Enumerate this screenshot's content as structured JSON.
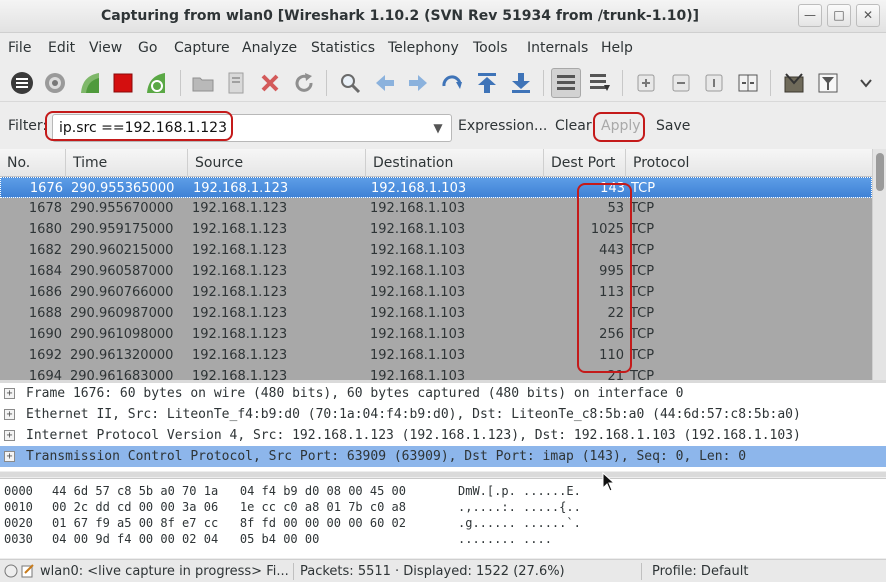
{
  "window": {
    "title": "Capturing from wlan0    [Wireshark 1.10.2  (SVN Rev 51934 from /trunk-1.10)]"
  },
  "menu": [
    "File",
    "Edit",
    "View",
    "Go",
    "Capture",
    "Analyze",
    "Statistics",
    "Telephony",
    "Tools",
    "Internals",
    "Help"
  ],
  "filter": {
    "label": "Filter:",
    "value": "ip.src ==192.168.1.123",
    "expression": "Expression...",
    "clear": "Clear",
    "apply": "Apply",
    "save": "Save"
  },
  "packet_list": {
    "columns": [
      "No.",
      "Time",
      "Source",
      "Destination",
      "Dest Port",
      "Protocol"
    ],
    "rows": [
      {
        "no": "1676",
        "time": "290.955365000",
        "src": "192.168.1.123",
        "dst": "192.168.1.103",
        "port": "143",
        "proto": "TCP"
      },
      {
        "no": "1678",
        "time": "290.955670000",
        "src": "192.168.1.123",
        "dst": "192.168.1.103",
        "port": "53",
        "proto": "TCP"
      },
      {
        "no": "1680",
        "time": "290.959175000",
        "src": "192.168.1.123",
        "dst": "192.168.1.103",
        "port": "1025",
        "proto": "TCP"
      },
      {
        "no": "1682",
        "time": "290.960215000",
        "src": "192.168.1.123",
        "dst": "192.168.1.103",
        "port": "443",
        "proto": "TCP"
      },
      {
        "no": "1684",
        "time": "290.960587000",
        "src": "192.168.1.123",
        "dst": "192.168.1.103",
        "port": "995",
        "proto": "TCP"
      },
      {
        "no": "1686",
        "time": "290.960766000",
        "src": "192.168.1.123",
        "dst": "192.168.1.103",
        "port": "113",
        "proto": "TCP"
      },
      {
        "no": "1688",
        "time": "290.960987000",
        "src": "192.168.1.123",
        "dst": "192.168.1.103",
        "port": "22",
        "proto": "TCP"
      },
      {
        "no": "1690",
        "time": "290.961098000",
        "src": "192.168.1.123",
        "dst": "192.168.1.103",
        "port": "256",
        "proto": "TCP"
      },
      {
        "no": "1692",
        "time": "290.961320000",
        "src": "192.168.1.123",
        "dst": "192.168.1.103",
        "port": "110",
        "proto": "TCP"
      },
      {
        "no": "1694",
        "time": "290.961683000",
        "src": "192.168.1.123",
        "dst": "192.168.1.103",
        "port": "21",
        "proto": "TCP"
      }
    ]
  },
  "details": [
    "Frame 1676: 60 bytes on wire (480 bits), 60 bytes captured (480 bits) on interface 0",
    "Ethernet II, Src: LiteonTe_f4:b9:d0 (70:1a:04:f4:b9:d0), Dst: LiteonTe_c8:5b:a0 (44:6d:57:c8:5b:a0)",
    "Internet Protocol Version 4, Src: 192.168.1.123 (192.168.1.123), Dst: 192.168.1.103 (192.168.1.103)",
    "Transmission Control Protocol, Src Port: 63909 (63909), Dst Port: imap (143), Seq: 0, Len: 0"
  ],
  "bytes": [
    {
      "offset": "0000",
      "hex": "44 6d 57 c8 5b a0 70 1a   04 f4 b9 d0 08 00 45 00",
      "ascii": "DmW.[.p. ......E."
    },
    {
      "offset": "0010",
      "hex": "00 2c dd cd 00 00 3a 06   1e cc c0 a8 01 7b c0 a8",
      "ascii": ".,....:. .....{.."
    },
    {
      "offset": "0020",
      "hex": "01 67 f9 a5 00 8f e7 cc   8f fd 00 00 00 00 60 02",
      "ascii": ".g...... ......`."
    },
    {
      "offset": "0030",
      "hex": "04 00 9d f4 00 00 02 04   05 b4 00 00",
      "ascii": "........ ...."
    }
  ],
  "status": {
    "capture": "wlan0: <live capture in progress> Fi...",
    "packets": "Packets: 5511 · Displayed: 1522 (27.6%)",
    "profile": "Profile: Default"
  },
  "colors": {
    "highlight": "#c41a1a",
    "selected_row": "#4a8ad9",
    "list_bg": "#a8a8a8",
    "detail_selected": "#8db6eb"
  },
  "toolbar_icons": [
    "interfaces-icon",
    "options-icon",
    "start-capture-icon",
    "stop-capture-icon",
    "restart-capture-icon",
    "open-file-icon",
    "save-file-icon",
    "close-file-icon",
    "reload-icon",
    "find-packet-icon",
    "go-back-icon",
    "go-forward-icon",
    "go-to-packet-icon",
    "go-first-icon",
    "go-last-icon",
    "colorize-icon",
    "autoscroll-icon",
    "zoom-in-icon",
    "zoom-out-icon",
    "normal-size-icon",
    "resize-columns-icon",
    "capture-filters-icon",
    "display-filters-icon",
    "more-icon"
  ]
}
